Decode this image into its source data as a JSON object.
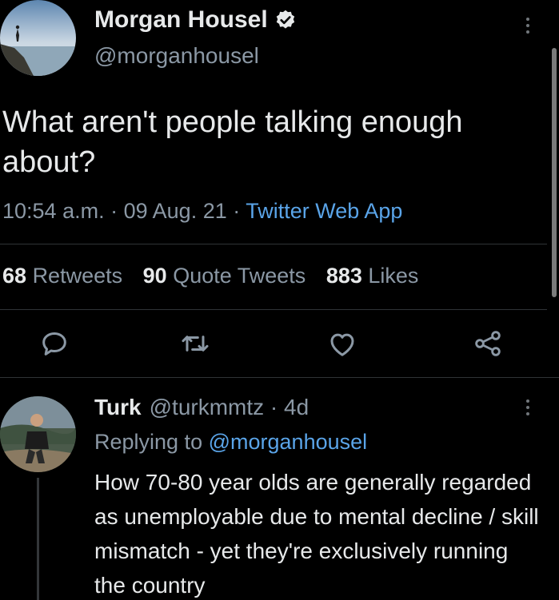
{
  "tweet": {
    "author": {
      "display_name": "Morgan Housel",
      "handle": "@morganhousel",
      "verified": true,
      "avatar_icon": "profile-photo-person-on-cliff"
    },
    "text": "What aren't people talking enough about?",
    "time": "10:54 a.m.",
    "date": "09 Aug. 21",
    "separator": "·",
    "source": "Twitter Web App",
    "stats": {
      "retweets_count": "68",
      "retweets_label": "Retweets",
      "quotes_count": "90",
      "quotes_label": "Quote Tweets",
      "likes_count": "883",
      "likes_label": "Likes"
    },
    "actions": [
      "reply-icon",
      "retweet-icon",
      "like-icon",
      "share-icon"
    ]
  },
  "reply": {
    "author": {
      "display_name": "Turk",
      "handle": "@turkmmtz",
      "age": "4d",
      "avatar_icon": "profile-photo-person-outdoors"
    },
    "replying_prefix": "Replying to",
    "replying_to": "@morganhousel",
    "text": "How 70-80 year olds are generally regarded as unemployable due to mental decline / skill mismatch - yet they're exclusively running the country"
  },
  "colors": {
    "background": "#000000",
    "text_primary": "#e7e9ea",
    "text_secondary": "#8b98a5",
    "link": "#5aa4e8",
    "divider": "#2f3336"
  }
}
